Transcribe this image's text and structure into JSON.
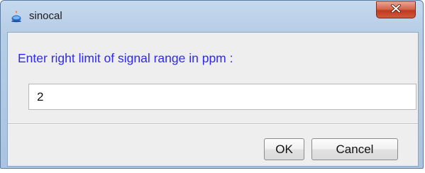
{
  "window": {
    "title": "sinocal",
    "icon": "java-app-icon",
    "close_icon": "close-icon",
    "close_label": "x"
  },
  "dialog": {
    "prompt": "Enter right limit of signal range in ppm :",
    "input_value": "2",
    "ok_label": "OK",
    "cancel_label": "Cancel"
  },
  "colors": {
    "prompt_text": "#2f29ee",
    "close_button": "#c0391e",
    "title_bar": "#b6cde6"
  }
}
